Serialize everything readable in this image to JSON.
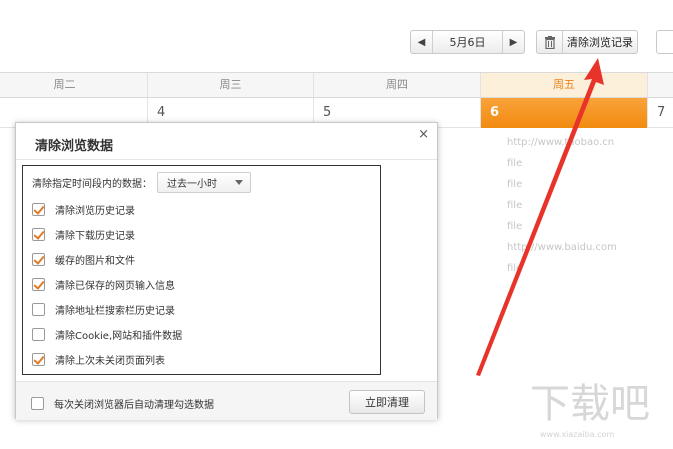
{
  "toolbar": {
    "prev_icon": "chevron-left-icon",
    "next_icon": "chevron-right-icon",
    "date": "5月6日",
    "clear_history_label": "清除浏览记录",
    "trash_icon": "trash-icon"
  },
  "calendar": {
    "days": [
      "周二",
      "周三",
      "周四",
      "周五"
    ],
    "dates": [
      "4",
      "5",
      "6",
      "7"
    ],
    "highlight_color": "#f28b10"
  },
  "background_entries": [
    "http://www.taobao.cn",
    "file",
    "file",
    "file",
    "file",
    "http://www.baidu.com",
    "file"
  ],
  "dialog": {
    "title": "清除浏览数据",
    "close_symbol": "×",
    "range_label": "清除指定时间段内的数据：",
    "range_value": "过去一小时",
    "options": [
      {
        "label": "清除浏览历史记录",
        "checked": true
      },
      {
        "label": "清除下载历史记录",
        "checked": true
      },
      {
        "label": "缓存的图片和文件",
        "checked": true
      },
      {
        "label": "清除已保存的网页输入信息",
        "checked": true
      },
      {
        "label": "清除地址栏搜索栏历史记录",
        "checked": false
      },
      {
        "label": "清除Cookie,网站和插件数据",
        "checked": false
      },
      {
        "label": "清除上次未关闭页面列表",
        "checked": true
      }
    ],
    "auto_clear_label": "每次关闭浏览器后自动清理勾选数据",
    "auto_clear_checked": false,
    "clear_now_label": "立即清理"
  },
  "watermark": {
    "logo": "下载吧",
    "url": "www.xiazaiba.com"
  },
  "annotation_color": "#e8332a"
}
